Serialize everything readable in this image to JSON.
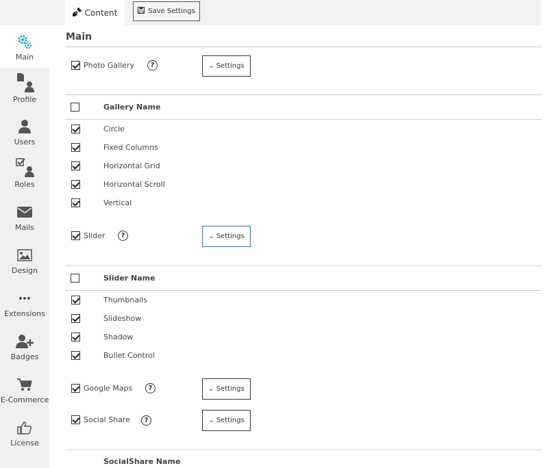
{
  "topbar": {
    "tab_content": "Content",
    "save_settings": "Save Settings"
  },
  "sidebar": {
    "items": [
      {
        "label": "Main",
        "icon": "gears-icon"
      },
      {
        "label": "Profile",
        "icon": "profile-icon"
      },
      {
        "label": "Users",
        "icon": "user-icon"
      },
      {
        "label": "Roles",
        "icon": "roles-icon"
      },
      {
        "label": "Mails",
        "icon": "envelope-icon"
      },
      {
        "label": "Design",
        "icon": "image-icon"
      },
      {
        "label": "Extensions",
        "icon": "ellipsis-icon"
      },
      {
        "label": "Badges",
        "icon": "user-plus-icon"
      },
      {
        "label": "E-Commerce",
        "icon": "cart-icon"
      },
      {
        "label": "License",
        "icon": "thumbs-up-icon"
      }
    ]
  },
  "main": {
    "heading": "Main",
    "photo_gallery": {
      "label": "Photo Gallery",
      "settings": "Settings",
      "table_header": "Gallery Name",
      "rows": [
        "Circle",
        "Fixed Columns",
        "Horizontal Grid",
        "Horizontal Scroll",
        "Vertical"
      ]
    },
    "slider": {
      "label": "Slider",
      "settings": "Settings",
      "table_header": "Slider Name",
      "rows": [
        "Thumbnails",
        "Slideshow",
        "Shadow",
        "Bullet Control"
      ]
    },
    "google_maps": {
      "label": "Google Maps",
      "settings": "Settings"
    },
    "social_share": {
      "label": "Social Share",
      "settings": "Settings",
      "table_header": "SocialShare Name"
    },
    "help_glyph": "?",
    "chevron_glyph": "⌄"
  },
  "colors": {
    "sidebar_bg": "#f0f0f0",
    "main_icon_accent": "#2aa6c9",
    "focus_border": "#3d6fb4"
  }
}
